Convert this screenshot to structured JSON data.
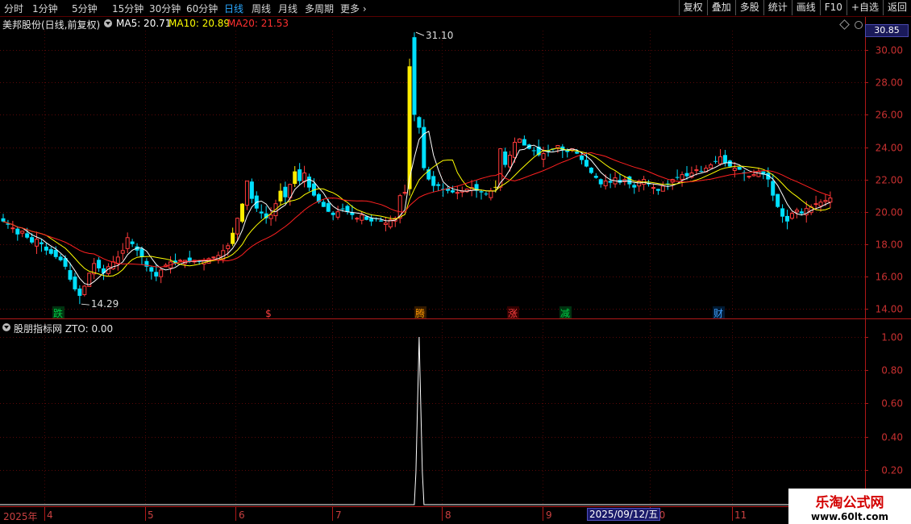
{
  "toolbar": {
    "tabs": [
      "分时",
      "1分钟",
      "5分钟",
      "15分钟",
      "30分钟",
      "60分钟",
      "日线",
      "周线",
      "月线",
      "多周期",
      "更多"
    ],
    "active_tab": "日线",
    "buttons": [
      "复权",
      "叠加",
      "多股",
      "统计",
      "画线",
      "F10",
      "+自选",
      "返回"
    ]
  },
  "header": {
    "stock_name": "美邦股份(日线,前复权)",
    "ma5_label": "MA5: 20.71",
    "ma10_label": "MA10: 20.89",
    "ma20_label": "MA20: 21.53",
    "current_price": "30.85"
  },
  "indicator": {
    "title": "股朋指标网 ZTO: 0.00"
  },
  "colors": {
    "up": "#ff3b3b",
    "down": "#00e0ff",
    "limit_up": "#ffee00",
    "ma5": "#ffffff",
    "ma10": "#ffff00",
    "ma20": "#ff2020",
    "axis": "#c02020"
  },
  "markers": {
    "high_label": "31.10",
    "low_label": "14.29",
    "event_tags": [
      {
        "text": "跌",
        "color": "#00cc44",
        "bg": "#003310"
      },
      {
        "text": "$",
        "color": "#ff4040",
        "bg": ""
      },
      {
        "text": "腾",
        "color": "#ff9900",
        "bg": "#331a00"
      },
      {
        "text": "涨",
        "color": "#ff4040",
        "bg": "#330000"
      },
      {
        "text": "减",
        "color": "#00cc44",
        "bg": "#003310"
      },
      {
        "text": "财",
        "color": "#40a0ff",
        "bg": "#001a33"
      }
    ]
  },
  "date_axis": {
    "labels": [
      "2025年",
      "4",
      "5",
      "6",
      "7",
      "8",
      "9",
      "10",
      "11"
    ],
    "cursor_date": "2025/09/12/五"
  },
  "watermark": {
    "line1": "乐淘公式网",
    "line2": "www.60lt.com"
  },
  "chart_data": [
    {
      "type": "candlestick",
      "title": "美邦股份(日线,前复权)",
      "y_ticks": [
        "30.00",
        "28.00",
        "26.00",
        "24.00",
        "22.00",
        "20.00",
        "18.00",
        "16.00",
        "14.00"
      ],
      "ylim": [
        13.5,
        31.5
      ],
      "annotations": {
        "high": 31.1,
        "low": 14.29
      },
      "closes": [
        19.4,
        19.2,
        19.0,
        18.6,
        18.8,
        18.4,
        18.1,
        18.3,
        18.0,
        17.6,
        17.4,
        17.2,
        17.0,
        16.6,
        15.8,
        15.2,
        14.8,
        15.4,
        16.2,
        16.8,
        16.5,
        16.2,
        16.6,
        16.9,
        17.2,
        17.6,
        18.4,
        18.0,
        17.6,
        17.2,
        16.6,
        16.3,
        16.0,
        16.4,
        16.7,
        16.9,
        16.8,
        17.0,
        17.0,
        16.9,
        17.0,
        16.9,
        17.0,
        17.1,
        17.2,
        17.3,
        17.6,
        17.9,
        18.7,
        19.6,
        20.5,
        21.9,
        20.8,
        20.2,
        19.9,
        19.6,
        19.8,
        20.5,
        21.3,
        20.9,
        21.7,
        22.5,
        21.9,
        22.4,
        21.5,
        21.0,
        20.6,
        20.3,
        20.0,
        19.8,
        20.0,
        20.2,
        20.0,
        19.8,
        19.6,
        19.8,
        19.5,
        19.4,
        19.6,
        19.4,
        19.3,
        19.5,
        19.6,
        21.0,
        21.2,
        29.0,
        26.0,
        25.2,
        22.7,
        22.0,
        21.6,
        21.6,
        21.4,
        21.3,
        21.2,
        21.2,
        21.3,
        21.4,
        21.5,
        21.3,
        21.2,
        21.1,
        21.3,
        21.5,
        23.9,
        22.9,
        23.5,
        24.3,
        24.5,
        24.1,
        23.9,
        23.8,
        23.5,
        23.6,
        23.7,
        23.9,
        24.1,
        23.8,
        23.7,
        23.9,
        23.6,
        23.2,
        22.8,
        22.4,
        22.1,
        21.7,
        21.9,
        21.8,
        22.1,
        21.8,
        22.0,
        21.7,
        21.5,
        21.9,
        22.0,
        21.7,
        21.5,
        21.3,
        21.6,
        21.7,
        22.0,
        22.1,
        22.3,
        22.2,
        22.4,
        22.6,
        22.5,
        22.7,
        22.9,
        23.1,
        23.4,
        23.0,
        22.8,
        22.7,
        22.6,
        22.4,
        22.2,
        22.3,
        22.5,
        22.3,
        22.0,
        21.0,
        20.3,
        19.7,
        19.4,
        19.9,
        20.1,
        19.9,
        20.2,
        20.3,
        20.5,
        20.6,
        20.7,
        20.85
      ],
      "limit_up_days": [
        48,
        50,
        58,
        61,
        85,
        103
      ],
      "series_names": [
        "MA5",
        "MA10",
        "MA20"
      ]
    },
    {
      "type": "line",
      "title": "股朋指标网 ZTO: 0.00",
      "y_ticks": [
        "1.00",
        "0.80",
        "0.60",
        "0.40",
        "0.20"
      ],
      "ylim": [
        0,
        1.05
      ],
      "peak_index": 87,
      "peak_value": 1.0
    }
  ]
}
